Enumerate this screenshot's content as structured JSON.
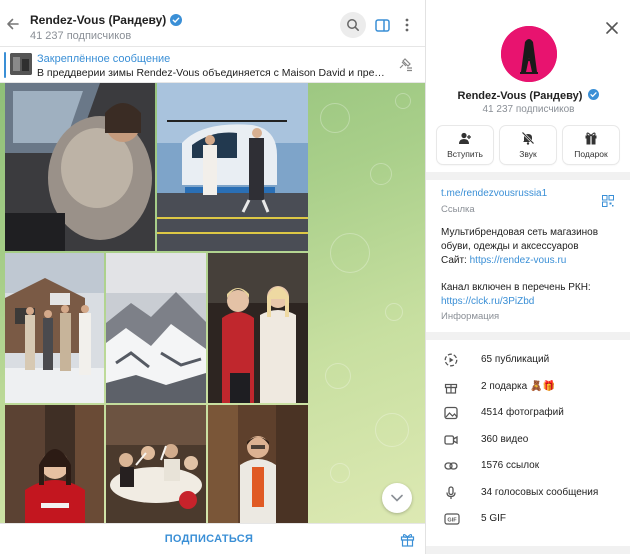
{
  "chat": {
    "title": "Rendez-Vous (Рандеву)",
    "subscribers": "41 237 подписчиков"
  },
  "pinned": {
    "title": "Закреплённое сообщение",
    "text": "В преддверии зимы Rendez-Vous объединяется с Maison David и представл..."
  },
  "bottom": {
    "subscribe_label": "ПОДПИСАТЬСЯ"
  },
  "profile": {
    "name": "Rendez-Vous (Рандеву)",
    "subscribers": "41 237 подписчиков",
    "actions": [
      {
        "label": "Вступить",
        "icon": "add-user-icon"
      },
      {
        "label": "Звук",
        "icon": "bell-muted-icon"
      },
      {
        "label": "Подарок",
        "icon": "gift-icon"
      }
    ],
    "link": "t.me/rendezvousrussia1",
    "link_caption": "Ссылка",
    "description_line1": "Мультибрендовая сеть магазинов",
    "description_line2": "обуви, одежды и аксессуаров",
    "site_label": "Сайт: ",
    "site_url": "https://rendez-vous.ru",
    "rkn_line": "Канал включен в перечень РКН:",
    "rkn_url": "https://clck.ru/3PiZbd",
    "info_caption": "Информация",
    "stats": [
      {
        "label": "65 публикаций",
        "icon": "posts-icon"
      },
      {
        "label": "2 подарка 🧸🎁",
        "icon": "gift-icon"
      },
      {
        "label": "4514 фотографий",
        "icon": "photo-icon"
      },
      {
        "label": "360 видео",
        "icon": "video-icon"
      },
      {
        "label": "1576 ссылок",
        "icon": "link-icon"
      },
      {
        "label": "34 голосовых сообщения",
        "icon": "microphone-icon"
      },
      {
        "label": "5 GIF",
        "icon": "gif-icon"
      }
    ]
  },
  "colors": {
    "accent": "#3a8fd6",
    "avatar": "#e8136f",
    "chat_background": "#a9cf8a"
  }
}
